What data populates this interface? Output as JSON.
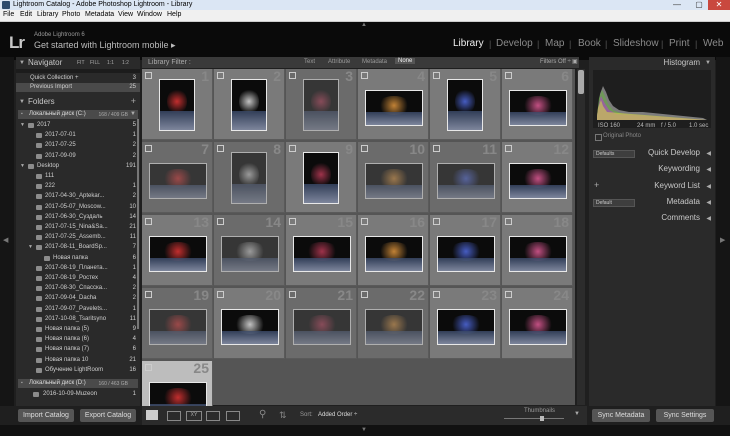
{
  "window": {
    "title": "Lightroom Catalog - Adobe Photoshop Lightroom - Library",
    "minimize": "—",
    "maximize": "▢",
    "close": "✕"
  },
  "menu": [
    "File",
    "Edit",
    "Library",
    "Photo",
    "Metadata",
    "View",
    "Window",
    "Help"
  ],
  "identity": {
    "logo": "Lr",
    "small": "Adobe Lightroom 6",
    "headline": "Get started with Lightroom mobile ▸"
  },
  "modules": [
    "Library",
    "Develop",
    "Map",
    "Book",
    "Slideshow",
    "Print",
    "Web"
  ],
  "active_module": "Library",
  "navigator": {
    "title": "Navigator",
    "zoom": [
      "FIT",
      "FILL",
      "1:1",
      "1:2"
    ]
  },
  "catalog": {
    "rows": [
      {
        "label": "Quick Collection +",
        "count": "3"
      },
      {
        "label": "Previous Import",
        "count": "25"
      }
    ]
  },
  "folders": {
    "title": "Folders",
    "disk_c": {
      "label": "Локальный диск (C:)",
      "size": "168 / 409 GB"
    },
    "disk_d": {
      "label": "Локальный диск (D:)",
      "size": "160 / 463 GB"
    },
    "items": [
      {
        "label": "2017",
        "count": "5",
        "indent": 1
      },
      {
        "label": "2017-07-01",
        "count": "1",
        "indent": 2
      },
      {
        "label": "2017-07-25",
        "count": "2",
        "indent": 2
      },
      {
        "label": "2017-09-09",
        "count": "2",
        "indent": 2
      },
      {
        "label": "Desktop",
        "count": "191",
        "indent": 1
      },
      {
        "label": "111",
        "count": "",
        "indent": 2
      },
      {
        "label": "222",
        "count": "1",
        "indent": 2
      },
      {
        "label": "2017-04-30_Aptekar...",
        "count": "2",
        "indent": 2
      },
      {
        "label": "2017-05-07_Moscow...",
        "count": "10",
        "indent": 2
      },
      {
        "label": "2017-06-30_Суздаль",
        "count": "14",
        "indent": 2
      },
      {
        "label": "2017-07-15_Nina&Sa...",
        "count": "21",
        "indent": 2
      },
      {
        "label": "2017-07-25_Assemb...",
        "count": "11",
        "indent": 2
      },
      {
        "label": "2017-08-11_BoardSp...",
        "count": "7",
        "indent": 2
      },
      {
        "label": "Новая папка",
        "count": "6",
        "indent": 3
      },
      {
        "label": "2017-08-19_Планета...",
        "count": "1",
        "indent": 2
      },
      {
        "label": "2017-08-19_Ростех",
        "count": "4",
        "indent": 2
      },
      {
        "label": "2017-08-30_Спасска...",
        "count": "2",
        "indent": 2
      },
      {
        "label": "2017-09-04_Dacha",
        "count": "2",
        "indent": 2
      },
      {
        "label": "2017-09-07_Pavelets...",
        "count": "1",
        "indent": 2
      },
      {
        "label": "2017-10-08_Tsaritsyno",
        "count": "11",
        "indent": 2
      },
      {
        "label": "Новая папка (5)",
        "count": "9",
        "indent": 2
      },
      {
        "label": "Новая папка (6)",
        "count": "4",
        "indent": 2
      },
      {
        "label": "Новая папка (7)",
        "count": "6",
        "indent": 2
      },
      {
        "label": "Новая папка 10",
        "count": "21",
        "indent": 2
      },
      {
        "label": "Обучение LightRoom",
        "count": "16",
        "indent": 2
      }
    ],
    "disk_d_item": {
      "label": "2016-10-09-Muzeon",
      "count": "1"
    }
  },
  "left_buttons": {
    "import": "Import Catalog",
    "export": "Export Catalog"
  },
  "filter": {
    "label": "Library Filter :",
    "options": [
      "Text",
      "Attribute",
      "Metadata",
      "None"
    ],
    "active": "None",
    "filters_off": "Filters Off ÷"
  },
  "grid": {
    "cells": [
      {
        "n": "1",
        "dim": false,
        "kind": "portrait"
      },
      {
        "n": "2",
        "dim": false,
        "kind": "portrait"
      },
      {
        "n": "3",
        "dim": true,
        "kind": "portrait"
      },
      {
        "n": "4",
        "dim": false,
        "kind": "landscape"
      },
      {
        "n": "5",
        "dim": false,
        "kind": "portrait"
      },
      {
        "n": "6",
        "dim": false,
        "kind": "landscape"
      },
      {
        "n": "7",
        "dim": true,
        "kind": "landscape"
      },
      {
        "n": "8",
        "dim": true,
        "kind": "portrait"
      },
      {
        "n": "9",
        "dim": false,
        "kind": "portrait"
      },
      {
        "n": "10",
        "dim": true,
        "kind": "landscape"
      },
      {
        "n": "11",
        "dim": true,
        "kind": "landscape"
      },
      {
        "n": "12",
        "dim": false,
        "kind": "landscape"
      },
      {
        "n": "13",
        "dim": false,
        "kind": "landscape"
      },
      {
        "n": "14",
        "dim": true,
        "kind": "landscape"
      },
      {
        "n": "15",
        "dim": false,
        "kind": "landscape"
      },
      {
        "n": "16",
        "dim": false,
        "kind": "landscape"
      },
      {
        "n": "17",
        "dim": false,
        "kind": "landscape"
      },
      {
        "n": "18",
        "dim": false,
        "kind": "landscape"
      },
      {
        "n": "19",
        "dim": true,
        "kind": "landscape"
      },
      {
        "n": "20",
        "dim": false,
        "kind": "landscape"
      },
      {
        "n": "21",
        "dim": true,
        "kind": "landscape"
      },
      {
        "n": "22",
        "dim": true,
        "kind": "landscape"
      },
      {
        "n": "23",
        "dim": false,
        "kind": "landscape"
      },
      {
        "n": "24",
        "dim": false,
        "kind": "landscape"
      },
      {
        "n": "25",
        "dim": false,
        "kind": "landscape"
      }
    ]
  },
  "toolbar": {
    "sort_label": "Sort:",
    "sort_value": "Added Order ÷",
    "thumbnails": "Thumbnails"
  },
  "histogram": {
    "title": "Histogram",
    "iso": "ISO 160",
    "focal": "24 mm",
    "aperture": "f / 5.0",
    "shutter": "1.0 sec",
    "original": "Original Photo"
  },
  "right_sections": [
    {
      "label": "Quick Develop",
      "preset": "Defaults"
    },
    {
      "label": "Keywording",
      "preset": ""
    },
    {
      "label": "Keyword List",
      "preset": ""
    },
    {
      "label": "Metadata",
      "preset": "Default"
    },
    {
      "label": "Comments",
      "preset": ""
    }
  ],
  "right_buttons": {
    "sync_meta": "Sync Metadata",
    "sync_settings": "Sync Settings"
  },
  "colors": {
    "active_module": "#f0f0f0",
    "inactive_module": "#8a8a8a",
    "panel": "#2a2a2a",
    "grid": "#555555"
  }
}
